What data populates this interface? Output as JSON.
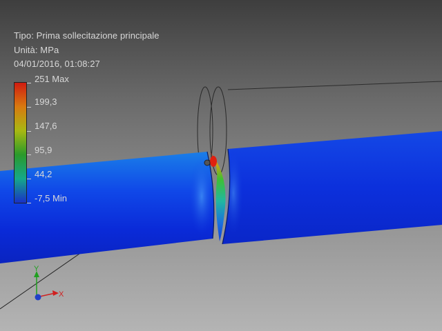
{
  "result_info": {
    "type_line": "Tipo: Prima sollecitazione principale",
    "unit_line": "Unità: MPa",
    "timestamp_line": "04/01/2016, 01:08:27"
  },
  "legend": {
    "labels": [
      "251 Max",
      "199,3",
      "147,6",
      "95,9",
      "44,2",
      "-7,5 Min"
    ],
    "colors": [
      "#d01c10",
      "#d87a10",
      "#a8b812",
      "#2a9a2a",
      "#15a88a",
      "#1830c8"
    ]
  },
  "triad": {
    "x_label": "X",
    "y_label": "Y",
    "x_color": "#d02020",
    "y_color": "#20a020",
    "z_color": "#2040c8"
  },
  "colors": {
    "pipe_low_stress": "#1030e0",
    "pipe_mid_stress": "#2a9af0",
    "hotspot_max": "#e02010",
    "background_top": "#3e3e3e",
    "background_bottom": "#b4b4b4"
  }
}
